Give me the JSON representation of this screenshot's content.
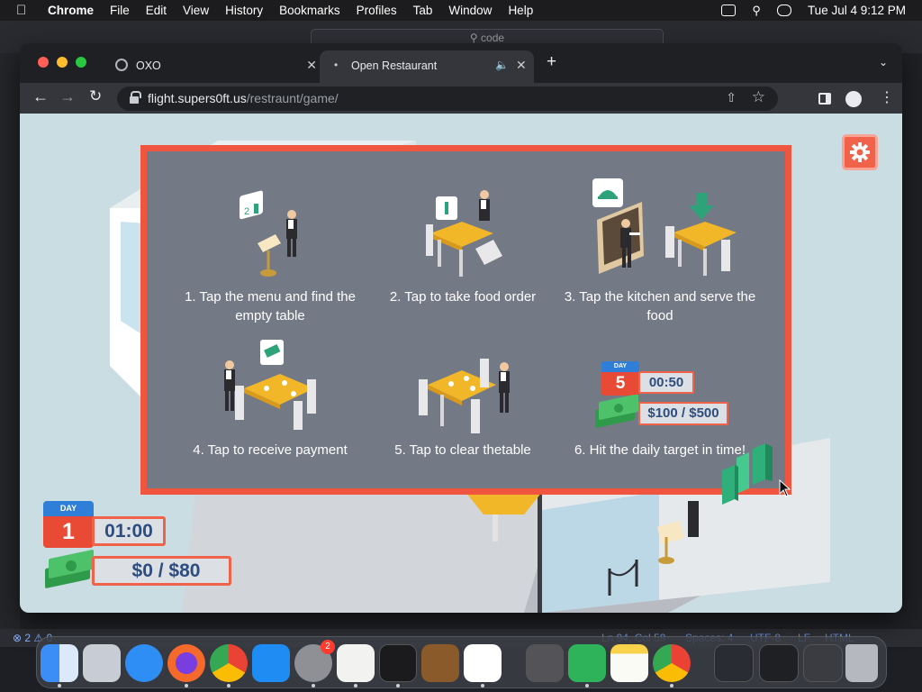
{
  "menubar": {
    "app": "Chrome",
    "items": [
      "File",
      "Edit",
      "View",
      "History",
      "Bookmarks",
      "Profiles",
      "Tab",
      "Window",
      "Help"
    ],
    "clock": "Tue Jul 4  9:12 PM"
  },
  "background": {
    "search_text": "code",
    "status_errors": "2",
    "status_warnings": "0",
    "status_position": "Ln 94, Col 59",
    "status_spaces": "Spaces: 4",
    "status_encoding": "UTF-8",
    "status_eol": "LF",
    "status_lang": "HTML"
  },
  "browser": {
    "tabs": [
      {
        "label": "OXO"
      },
      {
        "label": "Open Restaurant"
      }
    ],
    "url_host": "flight.supers0ft.us",
    "url_path": "/restraunt/game/"
  },
  "game": {
    "tutorial_steps": [
      {
        "text": "1. Tap the menu and find the empty table"
      },
      {
        "text": "2. Tap to take food order"
      },
      {
        "text": "3. Tap the kitchen and serve the food"
      },
      {
        "text": "4. Tap to receive payment"
      },
      {
        "text": "5. Tap to clear thetable"
      },
      {
        "text": "6. Hit the daily target in time!"
      }
    ],
    "tutorial_example": {
      "day_label": "DAY",
      "day_number": "5",
      "time": "00:50",
      "money": "$100 / $500"
    },
    "hud": {
      "day_label": "DAY",
      "day_number": "1",
      "time": "01:00",
      "money": "$0 / $80"
    }
  },
  "dock": {
    "badge_count": "2",
    "apps": [
      "finder-icon",
      "launchpad-icon",
      "safari-icon",
      "firefox-icon",
      "chrome-icon",
      "app-store-icon",
      "system-settings-icon",
      "textedit-icon",
      "terminal-icon",
      "garageband-icon",
      "vscode-icon",
      "calculator-icon",
      "numbers-icon",
      "notes-icon",
      "chrome-icon",
      "minimized-window-icon",
      "minimized-window-icon",
      "minimized-window-icon",
      "trash-icon"
    ]
  }
}
